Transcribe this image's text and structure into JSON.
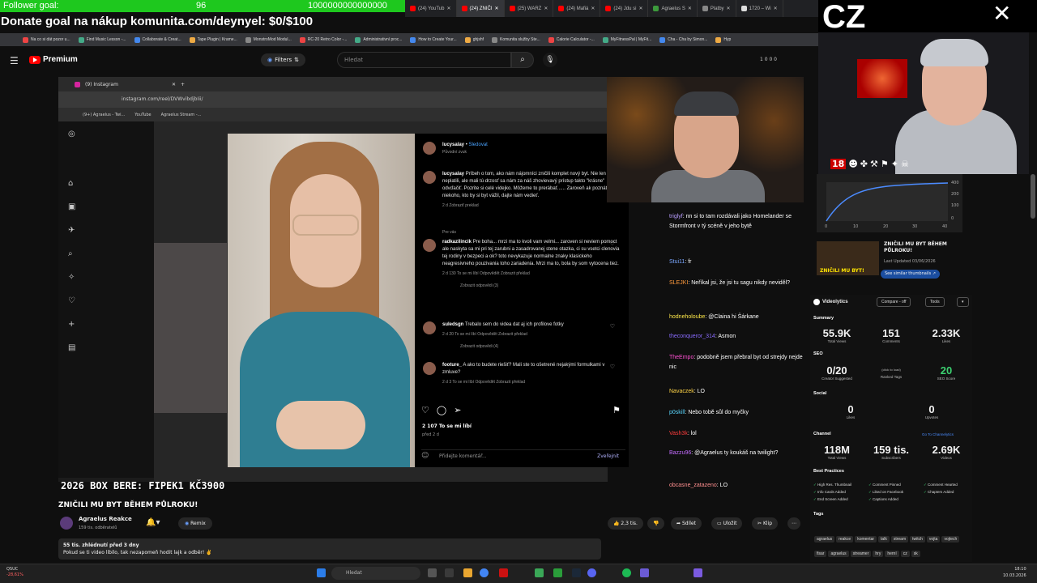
{
  "overlay": {
    "follower_label": "Follower goal:",
    "follower_value": "96",
    "big_number": "1000000000000000",
    "donate_text": "Donate goal na nákup komunita.com/deynyel: $0/$100"
  },
  "browser_tabs": [
    {
      "label": "(24) YouTub",
      "color": "#ff0000",
      "active": false
    },
    {
      "label": "(24) ZNIČI",
      "color": "#ff0000",
      "active": true
    },
    {
      "label": "(25) WARZ",
      "color": "#ff0000",
      "active": false
    },
    {
      "label": "(24) Mafiá",
      "color": "#ff0000",
      "active": false
    },
    {
      "label": "(24) Jdu si",
      "color": "#ff0000",
      "active": false
    },
    {
      "label": "Agraelus S",
      "color": "#3c9a3c",
      "active": false
    },
    {
      "label": "Platby",
      "color": "#888888",
      "active": false
    },
    {
      "label": "1720 – Wi",
      "color": "#dddddd",
      "active": false
    }
  ],
  "bookmarks": [
    "Na co si dát pozor u...",
    "Find Music Lesson -...",
    "Collaborate & Creat...",
    "Tape Plugin | Krame...",
    "MonstroMod Modul...",
    "RC-20 Retro Color -...",
    "Administrativní proc...",
    "How to Create Your...",
    "ghjshf",
    "Komunita služby Ste...",
    "Calorie Calculator -...",
    "MyFitnessPal | MyFit...",
    "Cha - Cha by Simon...",
    "Hyp"
  ],
  "youtube": {
    "logo_text": "Premium",
    "filters_label": "Filters",
    "search_placeholder": "Hledat",
    "counters": "1  0  0  0",
    "video_title": "ZNIČILI MU BYT BĚHEM PŮLROKU!",
    "channel_name": "Agraelus Reakce",
    "channel_subs": "159 tis. odběratelů",
    "remix_label": "Remix",
    "likes": "2,3 tis.",
    "share_label": "Sdílet",
    "save_label": "Uložit",
    "clip_label": "Klip",
    "views_line": "55 tis. zhlédnutí  před 3 dny",
    "desc_line": "Pokud se ti video líbilo, tak nezapomeň hodit lajk a odběr! ✌️"
  },
  "box_bere": "2026 BOX BERE: FIPEK1 KČ3900",
  "instagram": {
    "tab_label": "(9) Instagram",
    "url": "instagram.com/reel/DVWvibdjbIii/",
    "bookmarks": [
      "(9+) Agraelus - Twi...",
      "YouTube",
      "Agraelus Stream -..."
    ],
    "author": "lucysalay",
    "follow": "Sledovat",
    "audio": "Původní zvuk",
    "caption_user": "lucysalay",
    "caption": "Príbeh o tom, ako nám nájomníci zničili komplet nový byt. Nie len že neplatili, ale mali tú drzosť sa nám za náš zhovievavý prístup takto \"krásne\" odvďačiť. Pozrite si celé videjko. Môžeme to prerábať...... Zaroveň ak poznáte niekoho, kto by si byt vážil, dajte nám vedieť.",
    "caption_meta": "2 d    Zobraziť preklad",
    "pin_label": "Pre vás",
    "comments": [
      {
        "user": "radkazilincik",
        "text": "Pre boha... mrzi ma to kvoli vam velmi... zaroven si neviem pomoct ale naskyta sa mi pri tej zarubni a zasadrovanej stene otazka, ci su vsetci clenovia tej rodiny v bezpeci a ok? toto nevykazuje normalne znaky klasickeho neagresivneho pouzivania toho zariadenia. Mrzi ma to, bola by som vytocena tiez.",
        "meta": "2 d   130 To se mi líbí   Odpovědět   Zobrazit překlad",
        "replies": "Zobrazit odpovědi (3)"
      },
      {
        "user": "suledsgn",
        "text": "Trebalo sem do videa dat aj ich profilove fotky",
        "meta": "2 d   20 To se mi líbí   Odpovědět   Zobrazit překlad",
        "replies": "Zobrazit odpovědi (4)"
      },
      {
        "user": "footure_",
        "text": "A ako to budete riešiť? Mali ste to ošetrené nejakými formulkami v zmluve?",
        "meta": "2 d   3 To se mi líbí   Odpovědět   Zobrazit překlad",
        "replies": ""
      }
    ],
    "likes": "2 107 To se mi líbí",
    "date": "před 2 d",
    "comment_placeholder": "Přidejte komentář...",
    "publish": "Zveřejnit"
  },
  "chat": [
    {
      "user": "triglyf",
      "color": "#b89cff",
      "text": "nn si to tam rozdávali jako Homelander se Stormfront v tý scéně v jeho bytě"
    },
    {
      "user": "Stui11",
      "color": "#7aa7ff",
      "text": "fr"
    },
    {
      "user": "SLEJKI",
      "color": "#ff9a3c",
      "text": "Neříkal jsi, že jsi tu sagu nikdy neviděl?"
    },
    {
      "user": "hodneholoube",
      "color": "#ffe94a",
      "text": "@Claina hi Šárkane"
    },
    {
      "user": "theconqueror_314",
      "color": "#8a6cff",
      "text": "Asmon"
    },
    {
      "user": "TheEmpo",
      "color": "#ff4fd2",
      "text": "podobně jsem přebral byt od strejdy nejde nic"
    },
    {
      "user": "Navaczek",
      "color": "#ffd447",
      "text": "LO"
    },
    {
      "user": "p0skill",
      "color": "#5ad7ff",
      "text": "Nebo tobě sůl do myčky"
    },
    {
      "user": "Vash3k",
      "color": "#ff3c3c",
      "text": "lol"
    },
    {
      "user": "Bazzu96",
      "color": "#c46cff",
      "text": "@Agraelus ty koukáš na twilight?"
    },
    {
      "user": "obcasne_zatazeno",
      "color": "#ff8f8f",
      "text": "LO"
    }
  ],
  "streamer": {
    "title": "CZ",
    "badge18": "18"
  },
  "sidebar_video": {
    "thumb_text": "ZNIČILI MU BYT!",
    "title": "ZNIČILI MU BYT BĚHEM PŮLROKU!",
    "date": "Last Updated 03/06/2026",
    "similar_label": "See similar thumbnails ↗"
  },
  "graph": {
    "y_ticks": [
      "400",
      "200",
      "100",
      "0"
    ],
    "x_ticks": [
      "0",
      "10",
      "20",
      "30",
      "40"
    ]
  },
  "videolytics": {
    "title": "Videolytics",
    "compare": "Compare - off",
    "tools": "Tools",
    "summary_label": "Summary",
    "views": "55.9K",
    "views_label": "Total Views",
    "comments": "151",
    "comments_label": "Comments",
    "likes": "2.33K",
    "likes_label": "Likes",
    "seo_label": "SEO",
    "creator_tags": "0/20",
    "creator_tags_label": "Creator Suggested",
    "ranked_tags": "(click to load)",
    "ranked_tags_label": "Ranked Tags",
    "seo_score": "20",
    "seo_score_label": "SEO Score",
    "social_label": "Social",
    "social_likes": "0",
    "social_likes_label": "Likes",
    "upvotes": "0",
    "upvotes_label": "Upvotes",
    "channel_label": "Channel",
    "channel_link": "Go To Channelytics",
    "ch_views": "118M",
    "ch_views_label": "Total Views",
    "ch_subs": "159 tis.",
    "ch_subs_label": "Subscribers",
    "ch_videos": "2.69K",
    "ch_videos_label": "Videos",
    "bp_label": "Best Practices",
    "bp_items": [
      "High Res. Thumbnail",
      "Comment Pinned",
      "Comment Hearted",
      "Info Cards Added",
      "Liked on Facebook",
      "Chapters Added",
      "End Screen Added",
      "Captions Added"
    ],
    "tags_label": "Tags",
    "tags": [
      "agraelus",
      "reakce",
      "komentar",
      "talk",
      "stream",
      "twitch",
      "vojta",
      "vojtech",
      "fisar",
      "agraelus",
      "streamer",
      "hry",
      "herní",
      "cz",
      "sk"
    ]
  },
  "taskbar": {
    "weather_temp": "QSUC",
    "weather_sub": "-28,61%",
    "search": "Hledat",
    "time": "18:10",
    "date": "10.03.2026"
  }
}
